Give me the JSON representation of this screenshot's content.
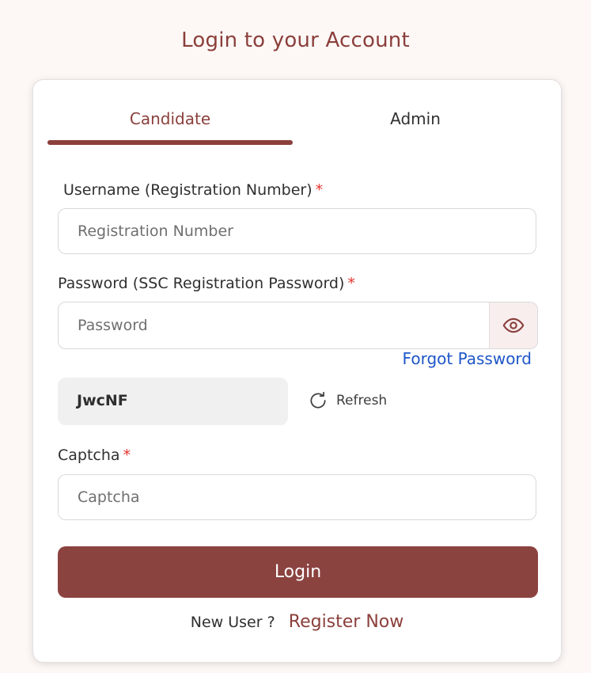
{
  "page": {
    "title": "Login to your Account"
  },
  "tabs": [
    {
      "label": "Candidate",
      "active": true
    },
    {
      "label": "Admin",
      "active": false
    }
  ],
  "username": {
    "label": "Username (Registration Number)",
    "required_mark": "*",
    "placeholder": "Registration Number",
    "value": ""
  },
  "password": {
    "label": "Password (SSC Registration Password)",
    "required_mark": "*",
    "placeholder": "Password",
    "value": "",
    "toggle_icon": "eye-icon"
  },
  "forgot_password": {
    "label": "Forgot Password"
  },
  "captcha_display": {
    "code": "JwcNF",
    "refresh_label": "Refresh",
    "refresh_icon": "refresh-icon"
  },
  "captcha": {
    "label": "Captcha",
    "required_mark": "*",
    "placeholder": "Captcha",
    "value": ""
  },
  "login_button": {
    "label": "Login"
  },
  "register": {
    "prompt": "New User ?",
    "link_label": "Register Now"
  },
  "colors": {
    "brand": "#8b3f3b",
    "link": "#1e56c9",
    "required": "#e5322d",
    "background": "#fdf8f6"
  }
}
